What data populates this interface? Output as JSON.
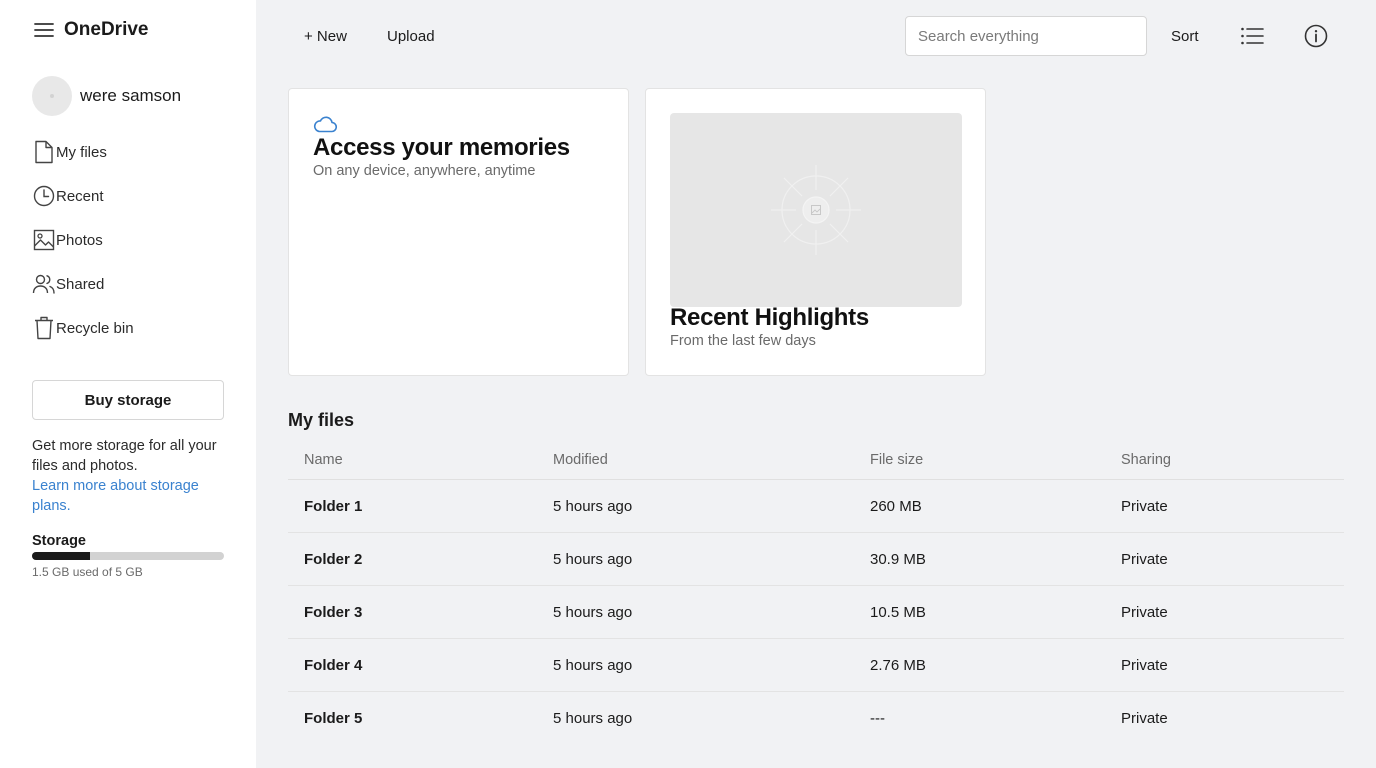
{
  "app": {
    "name": "OneDrive"
  },
  "user": {
    "name": "were samson"
  },
  "sidebar": {
    "items": [
      {
        "label": "My files",
        "icon": "file-icon"
      },
      {
        "label": "Recent",
        "icon": "clock-icon"
      },
      {
        "label": "Photos",
        "icon": "image-icon"
      },
      {
        "label": "Shared",
        "icon": "people-icon"
      },
      {
        "label": "Recycle bin",
        "icon": "trash-icon"
      }
    ],
    "buy_storage_label": "Buy storage",
    "promo_text": "Get more storage for all your files and photos.",
    "promo_link": "Learn more about storage plans.",
    "storage_title": "Storage",
    "storage_text": "1.5 GB used of 5 GB",
    "storage_used_fraction": 0.3
  },
  "toolbar": {
    "new_label": "+ New",
    "upload_label": "Upload",
    "search_placeholder": "Search everything",
    "sort_label": "Sort"
  },
  "cards": {
    "memories": {
      "title": "Access your memories",
      "subtitle": "On any device, anywhere, anytime"
    },
    "highlights": {
      "title": "Recent Highlights",
      "subtitle": "From the last few days"
    }
  },
  "files": {
    "section_title": "My files",
    "columns": {
      "name": "Name",
      "modified": "Modified",
      "size": "File size",
      "sharing": "Sharing"
    },
    "rows": [
      {
        "name": "Folder 1",
        "modified": "5 hours ago",
        "size": "260 MB",
        "sharing": "Private"
      },
      {
        "name": "Folder 2",
        "modified": "5 hours ago",
        "size": "30.9 MB",
        "sharing": "Private"
      },
      {
        "name": "Folder 3",
        "modified": "5 hours ago",
        "size": "10.5 MB",
        "sharing": "Private"
      },
      {
        "name": "Folder 4",
        "modified": "5 hours ago",
        "size": "2.76 MB",
        "sharing": "Private"
      },
      {
        "name": "Folder 5",
        "modified": "5 hours ago",
        "size": "---",
        "sharing": "Private"
      }
    ]
  },
  "colors": {
    "accent": "#3a82cf",
    "background": "#f1f2f4",
    "sidebar": "#ffffff"
  }
}
